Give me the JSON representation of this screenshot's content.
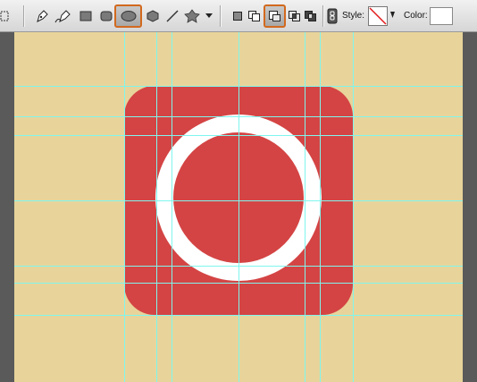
{
  "toolbar": {
    "tools": [
      {
        "name": "rectangular-marquee-icon",
        "active": false
      },
      {
        "name": "pen-tool-icon",
        "active": false
      },
      {
        "name": "freeform-pen-tool-icon",
        "active": false
      },
      {
        "name": "rectangle-tool-icon",
        "active": false
      },
      {
        "name": "rounded-rectangle-tool-icon",
        "active": false
      },
      {
        "name": "ellipse-tool-icon",
        "active": true
      },
      {
        "name": "polygon-tool-icon",
        "active": false
      },
      {
        "name": "line-tool-icon",
        "active": false
      },
      {
        "name": "custom-shape-tool-icon",
        "active": false
      }
    ],
    "path_modes": [
      {
        "name": "new-layer-mode-icon",
        "active": false
      },
      {
        "name": "add-mode-icon",
        "active": false
      },
      {
        "name": "subtract-mode-icon",
        "active": true
      },
      {
        "name": "intersect-mode-icon",
        "active": false
      },
      {
        "name": "exclude-mode-icon",
        "active": false
      }
    ],
    "link_icon": "link-icon",
    "style_label": "Style:",
    "color_label": "Color:",
    "color_value": "#ffffff"
  },
  "canvas": {
    "background_color": "#e8d49a",
    "shape_color": "#d44444",
    "ring_color": "#ffffff",
    "guide_color": "#7ff6ee"
  }
}
